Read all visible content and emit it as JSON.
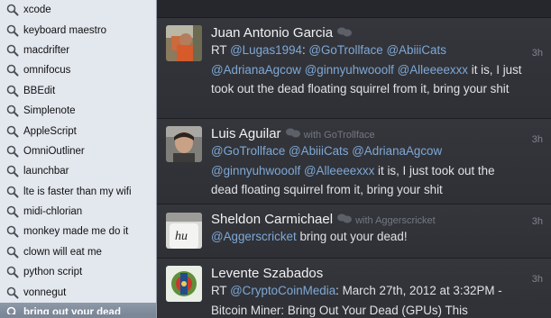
{
  "sidebar": {
    "searches": [
      {
        "label": "xcode"
      },
      {
        "label": "keyboard maestro"
      },
      {
        "label": "macdrifter"
      },
      {
        "label": "omnifocus"
      },
      {
        "label": "BBEdit"
      },
      {
        "label": "Simplenote"
      },
      {
        "label": "AppleScript"
      },
      {
        "label": "OmniOutliner"
      },
      {
        "label": "launchbar"
      },
      {
        "label": "lte is faster than my wifi"
      },
      {
        "label": "midi-chlorian"
      },
      {
        "label": "monkey made me do it"
      },
      {
        "label": "clown will eat me"
      },
      {
        "label": "python script"
      },
      {
        "label": "vonnegut"
      },
      {
        "label": "bring out your dead",
        "selected": true
      }
    ]
  },
  "tweets": [
    {
      "name": "Juan Antonio Garcia",
      "retweeted_by": "",
      "time": "3h",
      "body": [
        {
          "t": "RT ",
          "m": false
        },
        {
          "t": "@Lugas1994",
          "m": true
        },
        {
          "t": ": ",
          "m": false
        },
        {
          "t": "@GoTrollface",
          "m": true
        },
        {
          "t": " ",
          "m": false
        },
        {
          "t": "@AbiiiCats",
          "m": true
        },
        {
          "t": " ",
          "m": false
        },
        {
          "t": "@AdrianaAgcow",
          "m": true
        },
        {
          "t": " ",
          "m": false
        },
        {
          "t": "@ginnyuhwooolf",
          "m": true
        },
        {
          "t": " ",
          "m": false
        },
        {
          "t": "@Alleeeexxx",
          "m": true
        },
        {
          "t": " it is, I just took out the dead floating squirrel from it, bring your shit",
          "m": false
        }
      ]
    },
    {
      "name": "Luis Aguilar",
      "retweeted_by": "with GoTrollface",
      "time": "3h",
      "body": [
        {
          "t": "@GoTrollface",
          "m": true
        },
        {
          "t": " ",
          "m": false
        },
        {
          "t": "@AbiiiCats",
          "m": true
        },
        {
          "t": " ",
          "m": false
        },
        {
          "t": "@AdrianaAgcow",
          "m": true
        },
        {
          "t": " ",
          "m": false
        },
        {
          "t": "@ginnyuhwooolf",
          "m": true
        },
        {
          "t": " ",
          "m": false
        },
        {
          "t": "@Alleeeexxx",
          "m": true
        },
        {
          "t": " it is, I just took out the dead floating squirrel from it, bring your shit",
          "m": false
        }
      ]
    },
    {
      "name": "Sheldon Carmichael",
      "retweeted_by": "with Aggerscricket",
      "time": "3h",
      "body": [
        {
          "t": "@Aggerscricket",
          "m": true
        },
        {
          "t": " bring out your dead!",
          "m": false
        }
      ]
    },
    {
      "name": "Levente Szabados",
      "retweeted_by": "",
      "time": "3h",
      "body": [
        {
          "t": "RT ",
          "m": false
        },
        {
          "t": "@CryptoCoinMedia",
          "m": true
        },
        {
          "t": ": March 27th, 2012 at 3:32PM - Bitcoin Miner: Bring Out Your Dead (GPUs) This",
          "m": false
        }
      ]
    }
  ],
  "colors": {
    "mention": "#7fa8d6",
    "sidebar_bg": "#e3e7ee",
    "timeline_bg": "#2f3137",
    "selected_row": "#7b8696"
  },
  "icons": {
    "search_row": "magnifier-icon",
    "conversation": "conversation-bubbles-icon"
  }
}
